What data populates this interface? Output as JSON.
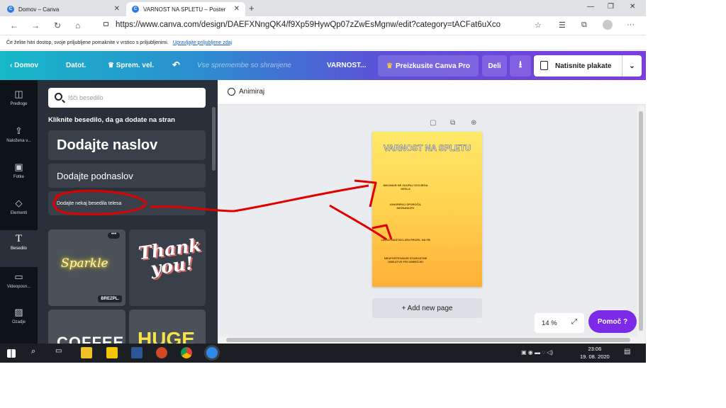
{
  "browser": {
    "tabs": [
      {
        "label": "Domov – Canva"
      },
      {
        "label": "VARNOST NA SPLETU – Poster"
      }
    ],
    "new_tab": "+",
    "url": "https://www.canva.com/design/DAEFXNngQK4/f9Xp59HywQp07zZwEsMgnw/edit?category=tACFat6uXco",
    "favorites_prompt": "Če želite hitri dostop, svoje priljubljene pomaknite v vrstico s priljubljenimi.",
    "favorites_link": "Upravljajte priljubljene zdaj"
  },
  "canva_header": {
    "home": "Domov",
    "file": "Datot.",
    "resize": "Sprem. vel.",
    "undo_icon": "undo-icon",
    "save_status": "Vse spremembe so shranjene",
    "design_title": "VARNOST...",
    "try_pro": "Preizkusite Canva Pro",
    "share": "Deli",
    "print": "Natisnite plakate"
  },
  "rail": {
    "items": [
      {
        "label": "Predloge",
        "icon": "templates-icon"
      },
      {
        "label": "Naložena v...",
        "icon": "upload-icon"
      },
      {
        "label": "Fotke",
        "icon": "photos-icon"
      },
      {
        "label": "Elementi",
        "icon": "elements-icon"
      },
      {
        "label": "Besedilo",
        "icon": "text-icon"
      },
      {
        "label": "Videoposn...",
        "icon": "video-icon"
      },
      {
        "label": "Ozadje",
        "icon": "background-icon"
      }
    ]
  },
  "text_panel": {
    "search_placeholder": "Išči besedilo",
    "title": "Kliknite besedilo, da ga dodate na stran",
    "add_heading": "Dodajte naslov",
    "add_subheading": "Dodajte podnaslov",
    "add_body": "Dodajte nekaj besedila telesa",
    "tiles": [
      {
        "text": "Sparkle",
        "badge": "BREZPL."
      },
      {
        "text": "Thank you!"
      },
      {
        "text": "COFFEE"
      },
      {
        "text": "HUGE"
      }
    ],
    "more_icon": "•••"
  },
  "canvas": {
    "animate": "Animiraj",
    "poster_title": "VARNOST NA SPLETU",
    "poster_lines": [
      "NIKOMUR NE ZAUPAJ SVOJEGA GESLA",
      "IGNORIRAJ SPOROČIL NEZNANCEV",
      "JAVNO NASTAVLJEN PROFIL NA FB",
      "NEUPOŠTEVANJE STAROSTNE OMEJITVE PRI OMREŽJIH"
    ],
    "add_page": "+ Add new page",
    "zoom": "14 %",
    "help": "Pomoč ?"
  },
  "taskbar": {
    "time": "23:06",
    "date": "19. 08. 2020"
  },
  "colors": {
    "annotation": "#e00000",
    "accent_purple": "#7d2ae8",
    "poster_top": "#ffe96a",
    "poster_bottom": "#ffb037"
  }
}
